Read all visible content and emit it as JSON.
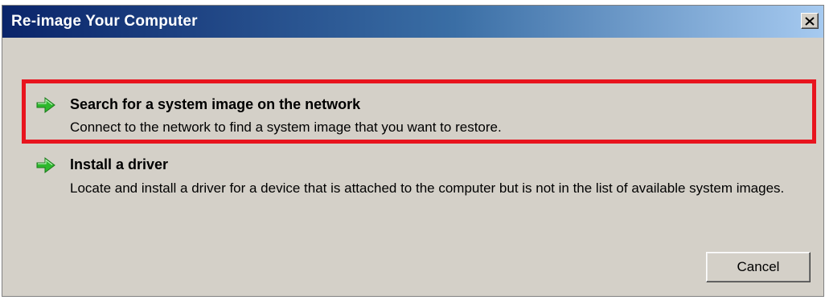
{
  "window": {
    "title": "Re-image Your Computer"
  },
  "options": [
    {
      "title": "Search for a system image on the network",
      "description": "Connect to the network to find a system image that you want to restore.",
      "icon": "green-arrow-icon",
      "highlighted": true
    },
    {
      "title": "Install a driver",
      "description": "Locate and install a driver for a device that is attached to the computer but is not in the list of available system images.",
      "icon": "green-arrow-icon",
      "highlighted": false
    }
  ],
  "buttons": {
    "cancel_label": "Cancel",
    "close_icon": "close-icon"
  },
  "colors": {
    "highlight_border": "#e8141e",
    "arrow_green": "#2eb82e",
    "titlebar_dark": "#0a246a",
    "dialog_bg": "#d4d0c8"
  }
}
